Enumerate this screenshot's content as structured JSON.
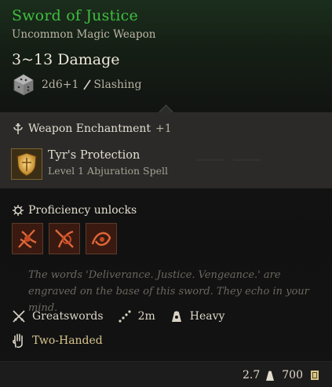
{
  "item": {
    "name": "Sword of Justice",
    "rarity_type": "Uncommon Magic Weapon",
    "damage": "3~13 Damage",
    "damage_dice": "2d6+1",
    "damage_type": "Slashing"
  },
  "enchantment": {
    "label": "Weapon Enchantment",
    "bonus": "+1",
    "spell_name": "Tyr's Protection",
    "spell_level": "Level 1 Abjuration Spell"
  },
  "proficiency": {
    "label": "Proficiency unlocks",
    "icons": [
      "proficiency-action-1",
      "proficiency-action-2",
      "proficiency-action-3"
    ]
  },
  "lore": "The words 'Deliverance. Justice. Vengeance.' are engraved on the base of this sword. They echo in your mind.",
  "properties": {
    "type": "Greatswords",
    "range": "2m",
    "weight_class": "Heavy",
    "handedness": "Two-Handed"
  },
  "footer": {
    "weight": "2.7",
    "value": "700"
  },
  "colors": {
    "title": "#3fbf3f",
    "handedness": "#d8c58c",
    "enchant_panel": "#2b2a29"
  }
}
